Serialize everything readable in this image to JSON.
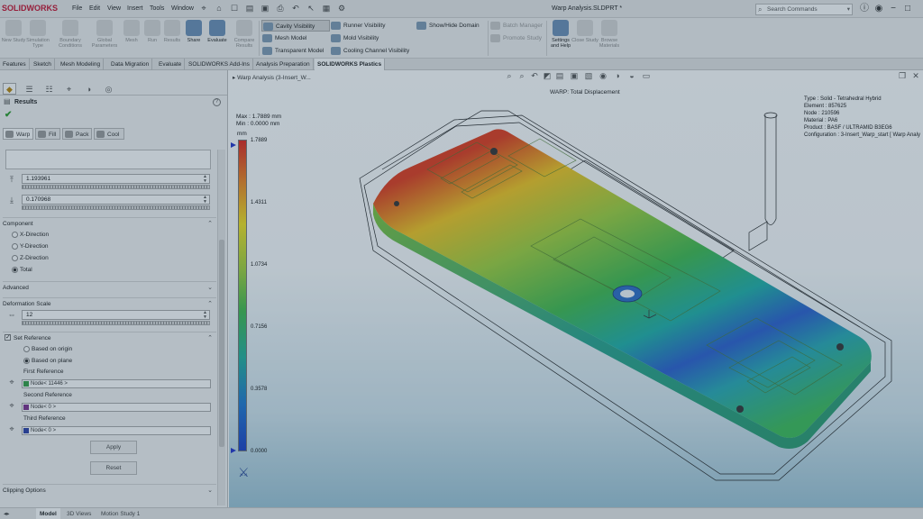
{
  "app": {
    "brand": "SOLIDWORKS",
    "document_title": "Warp Analysis.SLDPRT *"
  },
  "menu": [
    "File",
    "Edit",
    "View",
    "Insert",
    "Tools",
    "Window"
  ],
  "search": {
    "placeholder": "Search Commands"
  },
  "ribbon": {
    "left_buttons": [
      "New Study",
      "Simulation Type",
      "Boundary Conditions",
      "Global Parameters",
      "Mesh",
      "Run",
      "Results"
    ],
    "share": "Share",
    "evaluate": "Evaluate",
    "compare": "Compare Results",
    "col1": [
      "Cavity Visibility",
      "Mesh Model",
      "Transparent Model"
    ],
    "col2": [
      "Runner Visibility",
      "Mold Visibility",
      "Cooling Channel Visibility"
    ],
    "col3": [
      "Show/Hide Domain"
    ],
    "col4": [
      "Batch Manager",
      "Promote Study"
    ],
    "settings_help": "Settings and Help",
    "close_study": "Close Study",
    "browse_materials": "Browse Materials"
  },
  "command_tabs": [
    "Features",
    "Sketch",
    "Mesh Modeling",
    "Data Migration",
    "Evaluate",
    "SOLIDWORKS Add-Ins",
    "Analysis Preparation",
    "SOLIDWORKS Plastics"
  ],
  "panel": {
    "title": "Results",
    "subtabs": [
      "Warp",
      "Fill",
      "Pack",
      "Cool"
    ],
    "value1": "1.193961",
    "value2": "0.170968",
    "component": {
      "title": "Component",
      "options": [
        "X-Direction",
        "Y-Direction",
        "Z-Direction",
        "Total"
      ],
      "selected": "Total"
    },
    "advanced": "Advanced",
    "deformation_scale": {
      "title": "Deformation Scale",
      "value": "12"
    },
    "set_reference": {
      "title": "Set Reference",
      "options": [
        "Based on origin",
        "Based on plane"
      ],
      "selected": "Based on plane",
      "first_label": "First Reference",
      "first_value": "Node< 11446 >",
      "first_color": "#33a044",
      "second_label": "Second Reference",
      "second_value": "Node< 0 >",
      "second_color": "#7b2e8e",
      "third_label": "Third Reference",
      "third_value": "Node< 0 >",
      "third_color": "#2b3fa8"
    },
    "apply": "Apply",
    "reset": "Reset",
    "clipping": "Clipping Options"
  },
  "viewport": {
    "tree_item": "Warp Analysis (3-Insert_W...",
    "plot_title": "WARP: Total Displacement",
    "info": [
      "Type : Solid - Tetrahedral Hybrid",
      "Element : 857625",
      "Node : 210596",
      "Material : PA6",
      "Product : BASF / ULTRAMID B3EG6",
      "Configuration : 3-Insert_Warp_start [ Warp Analy"
    ],
    "max_text": "Max : 1.7889 mm",
    "min_text": "Min : 0.0000 mm",
    "unit": "mm",
    "legend_labels": [
      "1.7889",
      "1.4311",
      "1.0734",
      "0.7156",
      "0.3578",
      "0.0000"
    ],
    "legend_colors": [
      "#e2231a",
      "#f08a1d",
      "#f3e21e",
      "#9fd13a",
      "#3fbb4c",
      "#23b09c",
      "#1f78d1",
      "#1a3fc8"
    ]
  },
  "bottom_tabs": [
    "Model",
    "3D Views",
    "Motion Study 1"
  ]
}
